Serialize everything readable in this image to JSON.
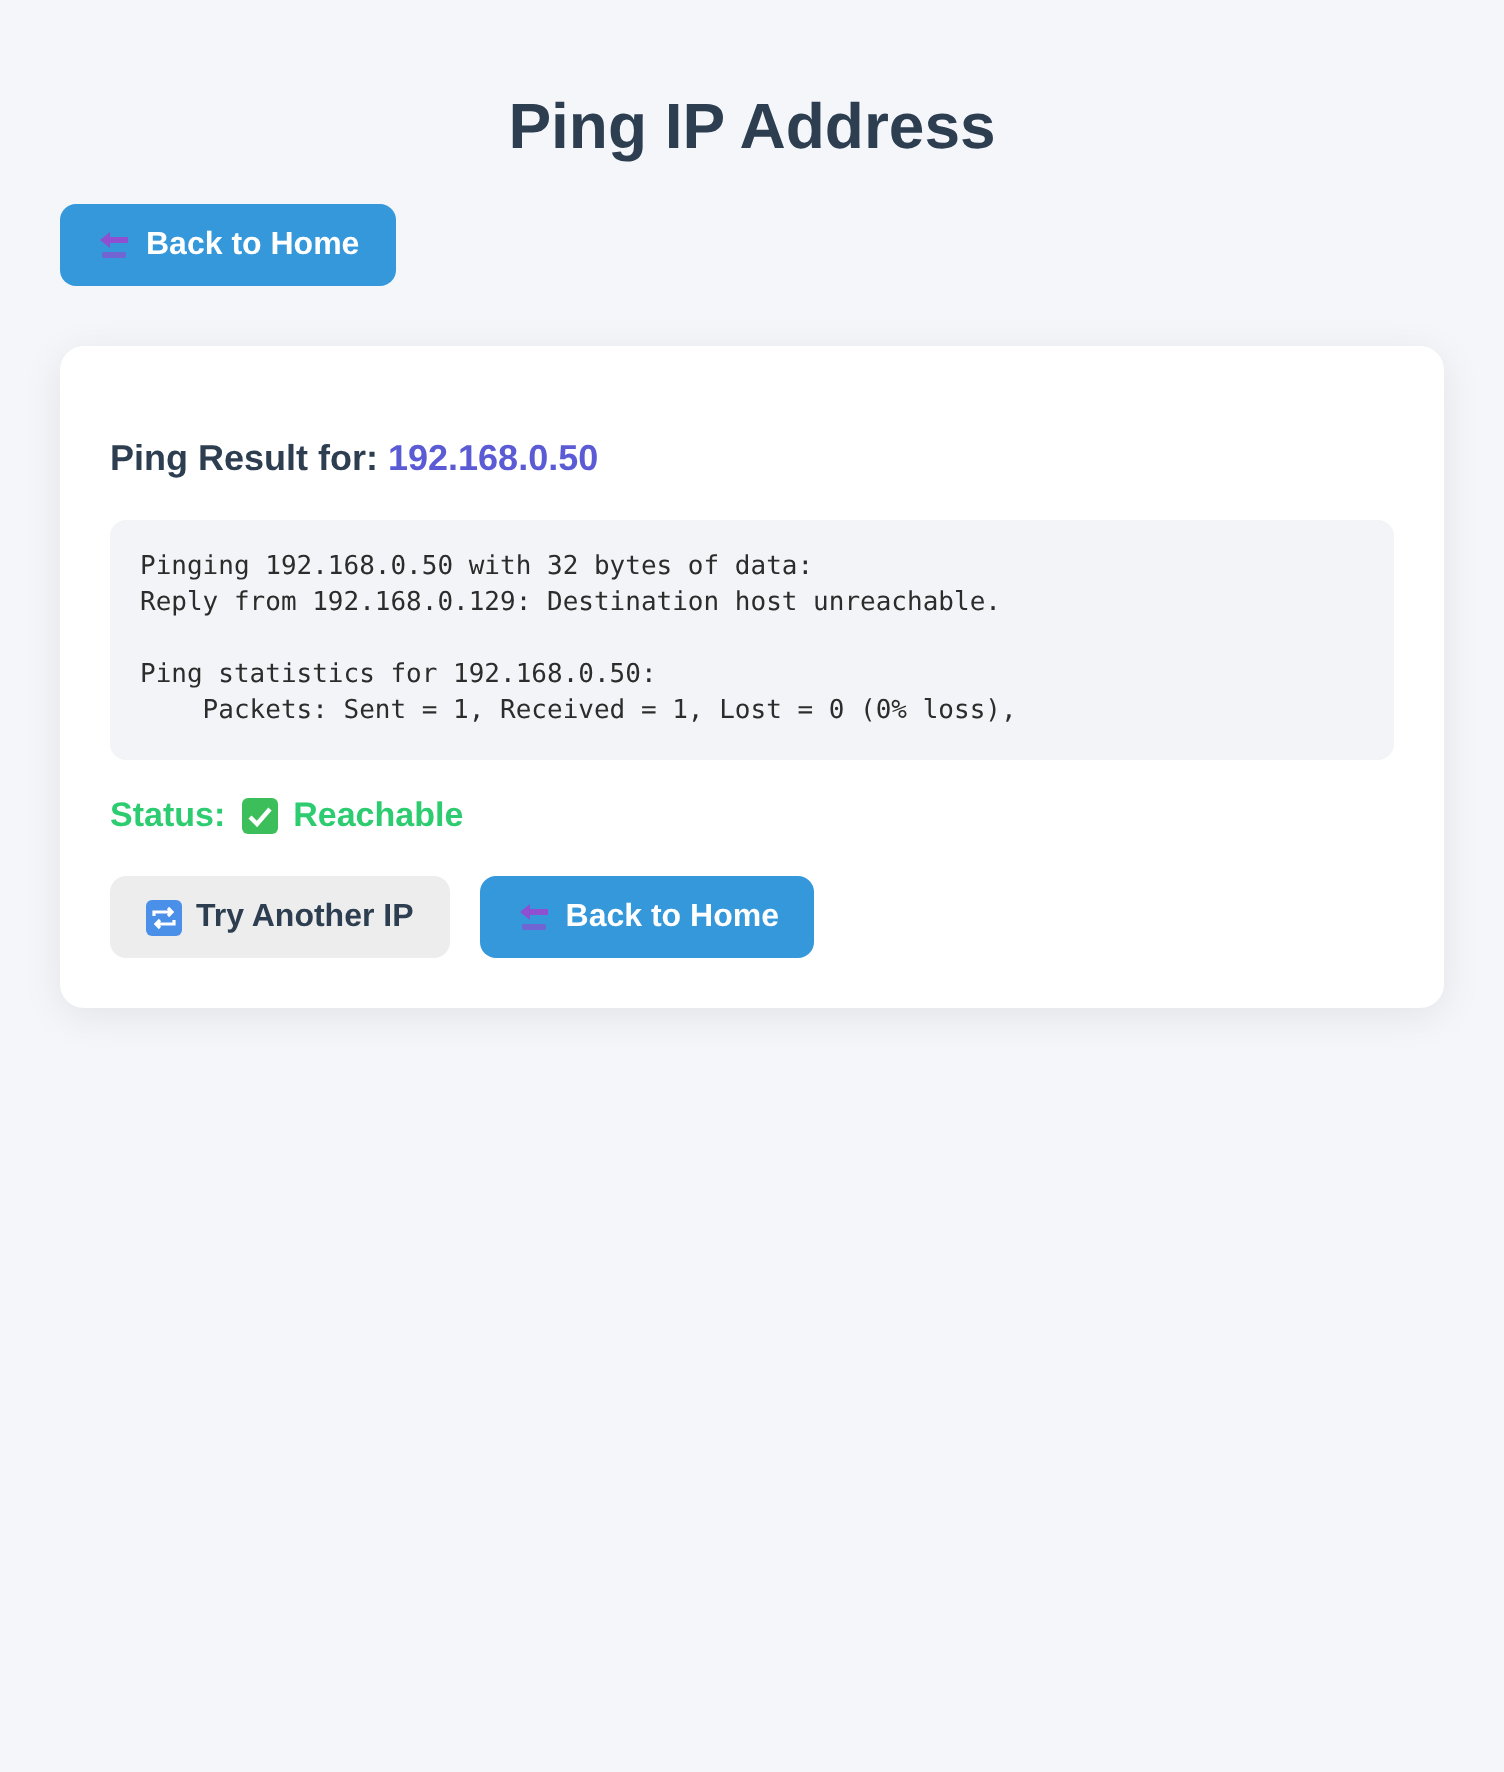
{
  "title": "Ping IP Address",
  "top_button": {
    "label": "Back to Home",
    "kind": "primary"
  },
  "result": {
    "heading": "Ping Result for:",
    "ip": "192.168.0.50",
    "output": "Pinging 192.168.0.50 with 32 bytes of data:\nReply from 192.168.0.129: Destination host unreachable.\n\nPing statistics for 192.168.0.50:\n    Packets: Sent = 1, Received = 1, Lost = 0 (0% loss),",
    "status_label": "Status:",
    "status_value": "Reachable",
    "reachable": true
  },
  "buttons": [
    {
      "label": "Try Another IP",
      "kind": "secondary"
    },
    {
      "label": "Back to Home",
      "kind": "primary"
    }
  ]
}
